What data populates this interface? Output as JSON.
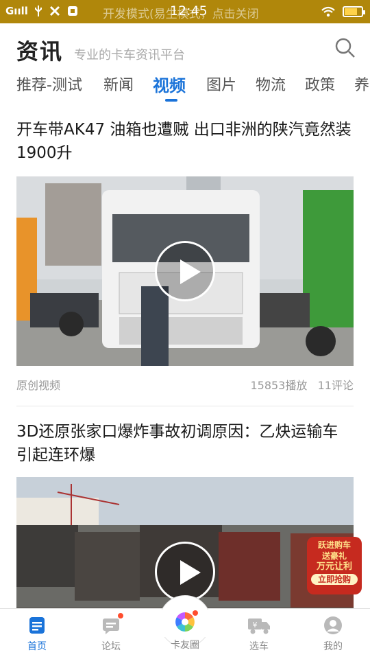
{
  "status_bar": {
    "carrier": "Gııll",
    "notice": "开发模式(易生模式，点击关闭",
    "time": "12:45",
    "battery_level": 0.75
  },
  "header": {
    "title": "资讯",
    "slogan": "专业的卡车资讯平台"
  },
  "tabs": [
    {
      "label": "推荐-测试",
      "active": false
    },
    {
      "label": "新闻",
      "active": false
    },
    {
      "label": "视频",
      "active": true
    },
    {
      "label": "图片",
      "active": false
    },
    {
      "label": "物流",
      "active": false
    },
    {
      "label": "政策",
      "active": false
    },
    {
      "label": "养",
      "active": false
    }
  ],
  "articles": [
    {
      "title": "开车带AK47 油箱也遭贼 出口非洲的陕汽竟然装1900升",
      "source": "原创视频",
      "plays": "15853播放",
      "comments": "11评论"
    },
    {
      "title": "3D还原张家口爆炸事故初调原因：乙炔运输车引起连环爆",
      "badge_lines": [
        "跃进购车",
        "送豪礼",
        "万元让利",
        "立即抢购"
      ]
    }
  ],
  "bottom_nav": [
    {
      "label": "首页",
      "icon": "home-doc-icon",
      "active": true
    },
    {
      "label": "论坛",
      "icon": "forum-chat-icon",
      "active": false,
      "dot": true
    },
    {
      "label": "卡友圈",
      "icon": "pinwheel-icon",
      "active": false,
      "dot": true
    },
    {
      "label": "选车",
      "icon": "truck-price-icon",
      "active": false
    },
    {
      "label": "我的",
      "icon": "user-profile-icon",
      "active": false
    }
  ],
  "colors": {
    "status_bar": "#b0870b",
    "accent": "#1a73d9",
    "notification_dot": "#ff4d2e"
  }
}
